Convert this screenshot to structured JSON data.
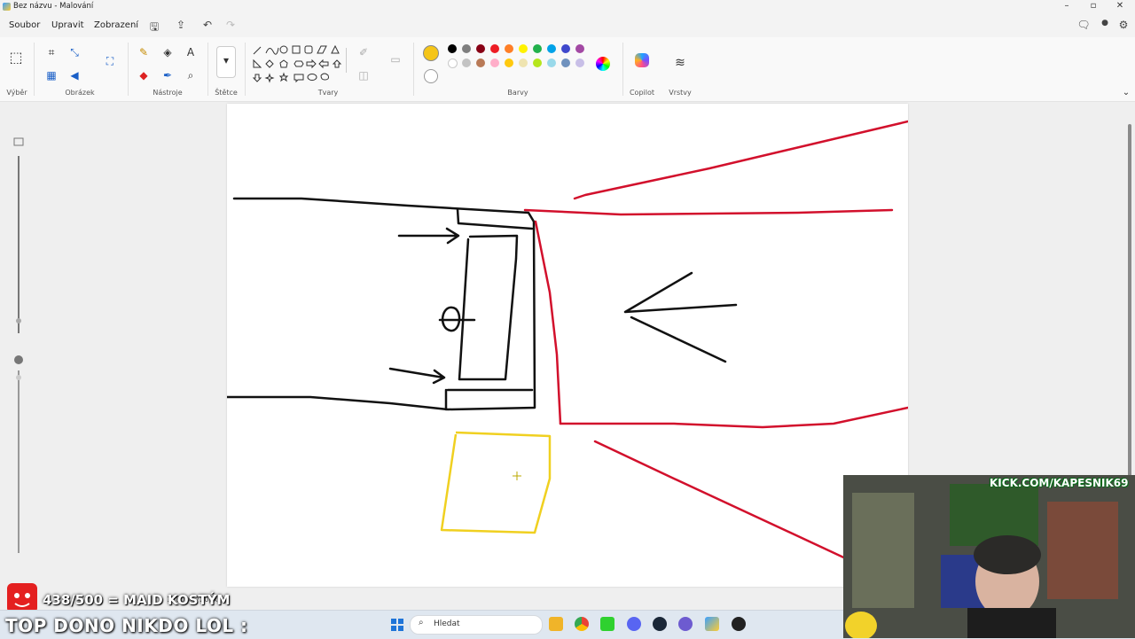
{
  "window": {
    "title": "Bez názvu - Malování"
  },
  "menu": {
    "items": [
      "Soubor",
      "Upravit",
      "Zobrazení"
    ]
  },
  "ribbon": {
    "groups": {
      "selection": "Výběr",
      "image": "Obrázek",
      "tools": "Nástroje",
      "brushes": "Štětce",
      "shapes": "Tvary",
      "colors": "Barvy",
      "copilot": "Copilot",
      "layers": "Vrstvy"
    },
    "primary_color": "#f5c518",
    "palette_row1": [
      "#000000",
      "#7f7f7f",
      "#880015",
      "#ed1c24",
      "#ff7f27",
      "#fff200",
      "#22b14c",
      "#00a2e8",
      "#3f48cc",
      "#a349a4"
    ],
    "palette_row2": [
      "#ffffff",
      "#c3c3c3",
      "#b97a57",
      "#ffaec9",
      "#ffc90e",
      "#efe4b0",
      "#b5e61d",
      "#99d9ea",
      "#7092be",
      "#c8bfe7"
    ]
  },
  "status": {
    "dimensions": "1280 × 720px"
  },
  "overlay": {
    "counter": "438/500 = MAID KOSTÝM",
    "message": "TOP DONO NIKDO LOL :"
  },
  "taskbar": {
    "search_placeholder": "Hledat"
  },
  "webcam": {
    "banner": "KICK.COM/KAPESNIK69"
  },
  "colors": {
    "red_stroke": "#d2102c",
    "yellow_stroke": "#f0d020",
    "black_stroke": "#111111"
  }
}
